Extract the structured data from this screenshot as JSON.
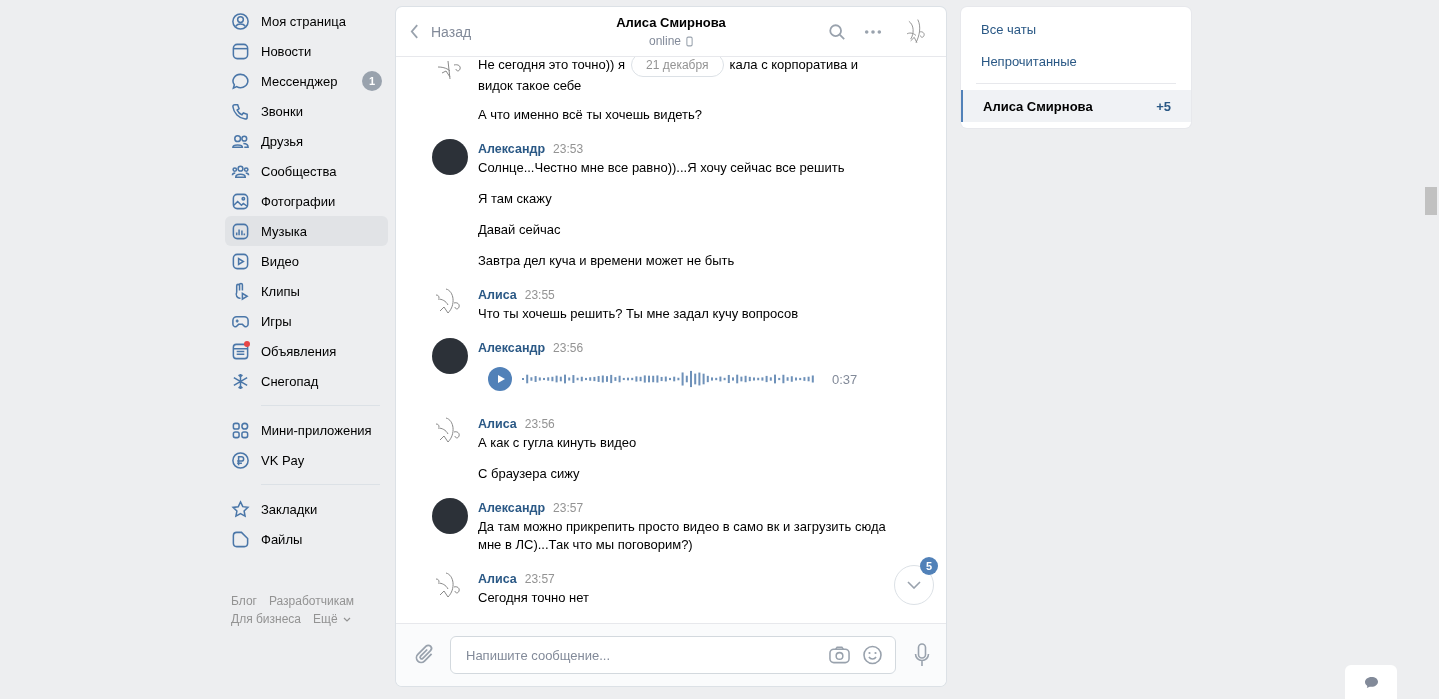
{
  "nav": {
    "groups": [
      [
        {
          "label": "Моя страница",
          "selected": false
        },
        {
          "label": "Новости",
          "selected": false
        },
        {
          "label": "Мессенджер",
          "selected": false,
          "badge": "1"
        },
        {
          "label": "Звонки",
          "selected": false
        },
        {
          "label": "Друзья",
          "selected": false
        },
        {
          "label": "Сообщества",
          "selected": false
        },
        {
          "label": "Фотографии",
          "selected": false
        },
        {
          "label": "Музыка",
          "selected": true
        },
        {
          "label": "Видео",
          "selected": false
        },
        {
          "label": "Клипы",
          "selected": false
        },
        {
          "label": "Игры",
          "selected": false
        },
        {
          "label": "Объявления",
          "selected": false,
          "notify": true
        },
        {
          "label": "Снегопад",
          "selected": false
        }
      ],
      [
        {
          "label": "Мини-приложения",
          "selected": false
        },
        {
          "label": "VK Pay",
          "selected": false
        }
      ],
      [
        {
          "label": "Закладки",
          "selected": false
        },
        {
          "label": "Файлы",
          "selected": false
        }
      ]
    ],
    "footer": [
      "Блог",
      "Разработчикам",
      "Для бизнеса",
      "Ещё"
    ]
  },
  "chat": {
    "back": "Назад",
    "title": "Алиса Смирнова",
    "status": "online",
    "date": "21 декабря",
    "first_message": {
      "before": "Не сегодня это точно)) я",
      "after": "кала с корпоратива и",
      "rest": "видок такое себе"
    },
    "groups": [
      {
        "messages": [
          {
            "kind": "text",
            "text": "А что именно всё ты хочешь видеть?"
          }
        ]
      },
      {
        "author": "Александр",
        "kind": "photo",
        "time": "23:53",
        "messages": [
          {
            "kind": "text",
            "text": "Солнце...Честно мне все равно))...Я хочу сейчас все решить"
          },
          {
            "kind": "text",
            "text": "Я там скажу"
          },
          {
            "kind": "text",
            "text": "Давай сейчас"
          },
          {
            "kind": "text",
            "text": "Завтра дел куча и времени может не быть"
          }
        ]
      },
      {
        "author": "Алиса",
        "kind": "sketch",
        "time": "23:55",
        "messages": [
          {
            "kind": "text",
            "text": "Что ты хочешь решить? Ты мне задал кучу вопросов"
          }
        ]
      },
      {
        "author": "Александр",
        "kind": "photo",
        "time": "23:56",
        "messages": [
          {
            "kind": "voice",
            "duration": "0:37"
          }
        ]
      },
      {
        "author": "Алиса",
        "kind": "sketch",
        "time": "23:56",
        "messages": [
          {
            "kind": "text",
            "text": "А как с гугла кинуть видео"
          },
          {
            "kind": "text",
            "text": "С браузера сижу"
          }
        ]
      },
      {
        "author": "Александр",
        "kind": "photo",
        "time": "23:57",
        "messages": [
          {
            "kind": "text",
            "text": "Да там можно прикрепить просто видео в само вк и загрузить сюда мне в ЛС)...Так что мы поговорим?)"
          }
        ]
      },
      {
        "author": "Алиса",
        "kind": "sketch",
        "time": "23:57",
        "messages": [
          {
            "kind": "text",
            "text": "Сегодня точно нет"
          }
        ]
      }
    ],
    "unread": "5",
    "composer": {
      "placeholder": "Напишите сообщение..."
    }
  },
  "filters": [
    {
      "label": "Все чаты",
      "selected": false
    },
    {
      "label": "Непрочитанные",
      "selected": false
    }
  ],
  "conversations": [
    {
      "name": "Алиса Смирнова",
      "count": "+5",
      "selected": true
    }
  ]
}
